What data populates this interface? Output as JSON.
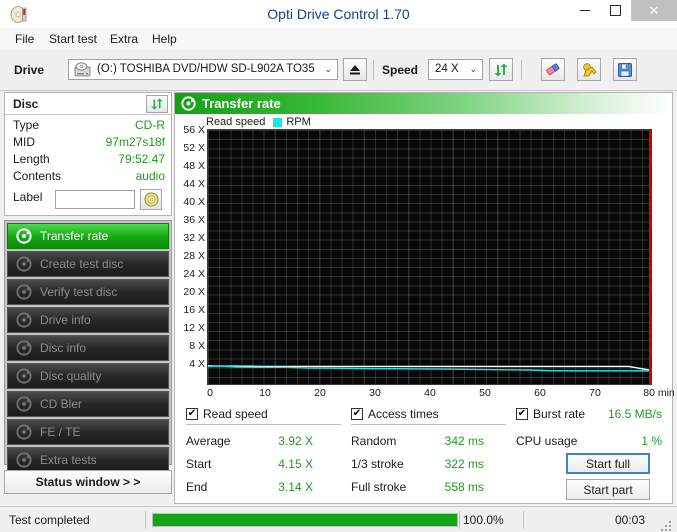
{
  "window": {
    "title": "Opti Drive Control 1.70",
    "icon": "cd-disc-icon",
    "controls": {
      "minimize": "–",
      "maximize": "□",
      "close": "✕"
    }
  },
  "menu": {
    "items": [
      {
        "label": "File"
      },
      {
        "label": "Start test"
      },
      {
        "label": "Extra"
      },
      {
        "label": "Help"
      }
    ]
  },
  "toolbar": {
    "drive_label": "Drive",
    "drive_value": "(O:)   TOSHIBA DVD/HDW SD-L902A TO35",
    "speed_label": "Speed",
    "speed_value": "24 X",
    "dropdown_arrow": "⌄",
    "buttons": [
      {
        "name": "eject-button",
        "icon": "eject-icon"
      },
      {
        "name": "refresh-drive-button",
        "icon": "refresh-arrows-icon"
      },
      {
        "name": "erase-button",
        "icon": "eraser-icon"
      },
      {
        "name": "clamp-button",
        "icon": "yellow-clamp-icon"
      },
      {
        "name": "save-button",
        "icon": "floppy-save-icon"
      }
    ]
  },
  "disc_panel": {
    "title": "Disc",
    "refresh_icon": "refresh-arrows-icon",
    "rows": [
      {
        "key": "Type",
        "value": "CD-R"
      },
      {
        "key": "MID",
        "value": "97m27s18f"
      },
      {
        "key": "Length",
        "value": "79:52.47"
      },
      {
        "key": "Contents",
        "value": "audio"
      }
    ],
    "label_key": "Label",
    "label_value": "",
    "label_placeholder": "",
    "label_button_icon": "cd-disc-icon"
  },
  "sidebar": {
    "items": [
      {
        "label": "Transfer rate",
        "icon": "disc-test-icon",
        "active": true
      },
      {
        "label": "Create test disc",
        "icon": "disc-test-icon",
        "active": false
      },
      {
        "label": "Verify test disc",
        "icon": "disc-test-icon",
        "active": false
      },
      {
        "label": "Drive info",
        "icon": "disc-test-icon",
        "active": false
      },
      {
        "label": "Disc info",
        "icon": "disc-test-icon",
        "active": false
      },
      {
        "label": "Disc quality",
        "icon": "disc-test-icon",
        "active": false
      },
      {
        "label": "CD Bler",
        "icon": "disc-test-icon",
        "active": false
      },
      {
        "label": "FE / TE",
        "icon": "disc-test-icon",
        "active": false
      },
      {
        "label": "Extra tests",
        "icon": "disc-test-icon",
        "active": false
      }
    ],
    "status_window_button": "Status window > >"
  },
  "main": {
    "header_title": "Transfer rate",
    "header_icon": "disc-test-icon"
  },
  "chart_data": {
    "type": "line",
    "title": "Transfer rate",
    "xlabel": "min",
    "ylabel": "X",
    "xlim": [
      0,
      80
    ],
    "ylim": [
      0,
      58
    ],
    "grid": true,
    "legend_position": "top-left",
    "x_ticks": [
      0,
      10,
      20,
      30,
      40,
      50,
      60,
      70,
      80
    ],
    "x_tick_labels": [
      "0",
      "10",
      "20",
      "30",
      "40",
      "50",
      "60",
      "70",
      "80 min"
    ],
    "y_ticks": [
      0,
      4,
      8,
      12,
      16,
      20,
      24,
      28,
      32,
      36,
      40,
      44,
      48,
      52,
      56
    ],
    "y_tick_labels": [
      "0",
      "4 X",
      "8 X",
      "12 X",
      "16 X",
      "20 X",
      "24 X",
      "28 X",
      "32 X",
      "36 X",
      "40 X",
      "44 X",
      "48 X",
      "52 X",
      "56 X"
    ],
    "end_marker_x": 80,
    "end_marker_color": "#d40000",
    "legend": [
      {
        "name": "Read speed",
        "color": "#ffffff",
        "marker": "line"
      },
      {
        "name": "RPM",
        "color": "#19e6e6",
        "marker": "square"
      }
    ],
    "series": [
      {
        "name": "Read speed",
        "color": "#ffffff",
        "x": [
          0,
          2,
          4,
          6,
          8,
          10,
          13,
          16,
          20,
          24,
          28,
          32,
          36,
          40,
          44,
          48,
          52,
          56,
          60,
          64,
          68,
          72,
          76,
          79.9
        ],
        "values": [
          4.15,
          4.1,
          4.08,
          4.05,
          4.05,
          4.02,
          4.0,
          4.0,
          4.0,
          4.0,
          4.0,
          4.0,
          4.0,
          4.0,
          4.0,
          4.0,
          4.0,
          4.0,
          4.0,
          4.0,
          4.0,
          4.0,
          4.0,
          3.14
        ]
      },
      {
        "name": "RPM",
        "color": "#19e6e6",
        "x": [
          0,
          2,
          3,
          5,
          7,
          10,
          14,
          18,
          22,
          26,
          30,
          34,
          38,
          42,
          46,
          50,
          54,
          58,
          62,
          66,
          70,
          74,
          79.9
        ],
        "values": [
          4.0,
          4.1,
          4.05,
          3.9,
          3.85,
          3.8,
          3.8,
          3.65,
          3.6,
          3.55,
          3.5,
          3.5,
          3.45,
          3.4,
          3.35,
          3.3,
          3.25,
          3.2,
          3.05,
          3.0,
          3.0,
          3.0,
          3.0
        ]
      }
    ]
  },
  "stats": {
    "read_speed": {
      "checked": true,
      "check_glyph": "✔",
      "title": "Read speed",
      "rows": [
        {
          "key": "Average",
          "value": "3.92 X"
        },
        {
          "key": "Start",
          "value": "4.15 X"
        },
        {
          "key": "End",
          "value": "3.14 X"
        }
      ]
    },
    "access_times": {
      "checked": true,
      "check_glyph": "✔",
      "title": "Access times",
      "rows": [
        {
          "key": "Random",
          "value": "342 ms"
        },
        {
          "key": "1/3 stroke",
          "value": "322 ms"
        },
        {
          "key": "Full stroke",
          "value": "558 ms"
        }
      ]
    },
    "burst": {
      "checked": true,
      "check_glyph": "✔",
      "title": "Burst rate",
      "value": "16.5 MB/s",
      "cpu_key": "CPU usage",
      "cpu_value": "1 %",
      "start_full_button": "Start full",
      "start_part_button": "Start part"
    }
  },
  "statusbar": {
    "message": "Test completed",
    "percent_text": "100.0%",
    "percent_value": 100,
    "elapsed": "00:03"
  },
  "colors": {
    "accent_green": "#11a611",
    "value_green": "#1f9c1f",
    "read_speed_line": "#ffffff",
    "rpm_line": "#19e6e6",
    "end_marker": "#d40000",
    "plot_bg": "#080808"
  }
}
